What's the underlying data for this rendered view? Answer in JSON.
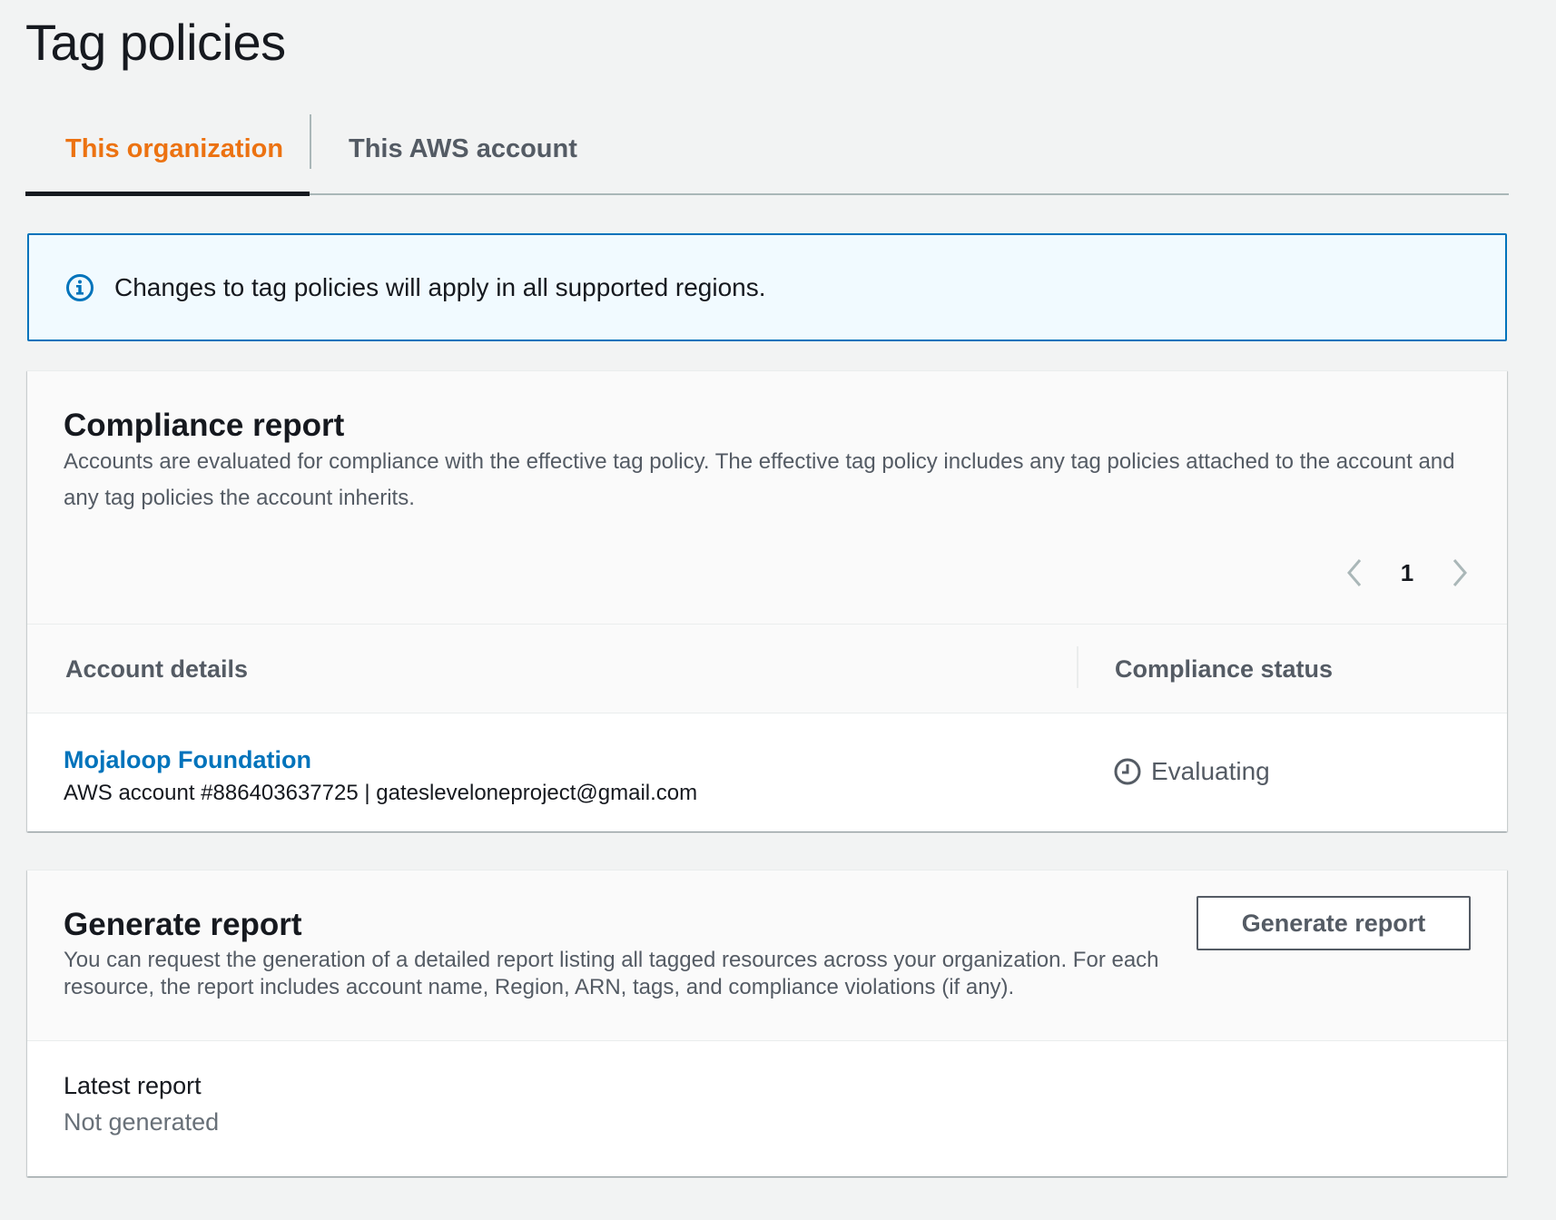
{
  "page": {
    "title": "Tag policies"
  },
  "tabs": [
    {
      "label": "This organization",
      "active": true
    },
    {
      "label": "This AWS account",
      "active": false
    }
  ],
  "info_alert": {
    "icon": "info-icon",
    "text": "Changes to tag policies will apply in all supported regions."
  },
  "compliance_report": {
    "title": "Compliance report",
    "description": "Accounts are evaluated for compliance with the effective tag policy. The effective tag policy includes any tag policies attached to the account and any tag policies the account inherits.",
    "pagination": {
      "current_page": "1",
      "prev_icon": "chevron-left-icon",
      "next_icon": "chevron-right-icon"
    },
    "columns": [
      "Account details",
      "Compliance status"
    ],
    "rows": [
      {
        "account_name": "Mojaloop Foundation",
        "account_meta": "AWS account #886403637725 | gateslevelonepr oject@gmail.com",
        "status": "Evaluating",
        "status_icon": "clock-icon"
      }
    ]
  },
  "generate_report": {
    "title": "Generate report",
    "description": "You can request the generation of a detailed report listing all tagged resources across your organization. For each resource, the report includes account name, Region, ARN, tags, and compliance violations (if any).",
    "button_label": "Generate report",
    "latest_label": "Latest report",
    "latest_value": "Not generated"
  },
  "colors": {
    "accent": "#ec7211",
    "link": "#0073bb",
    "info_border": "#0073bb",
    "info_bg": "#f1faff",
    "text": "#16191f",
    "muted": "#545b64"
  }
}
